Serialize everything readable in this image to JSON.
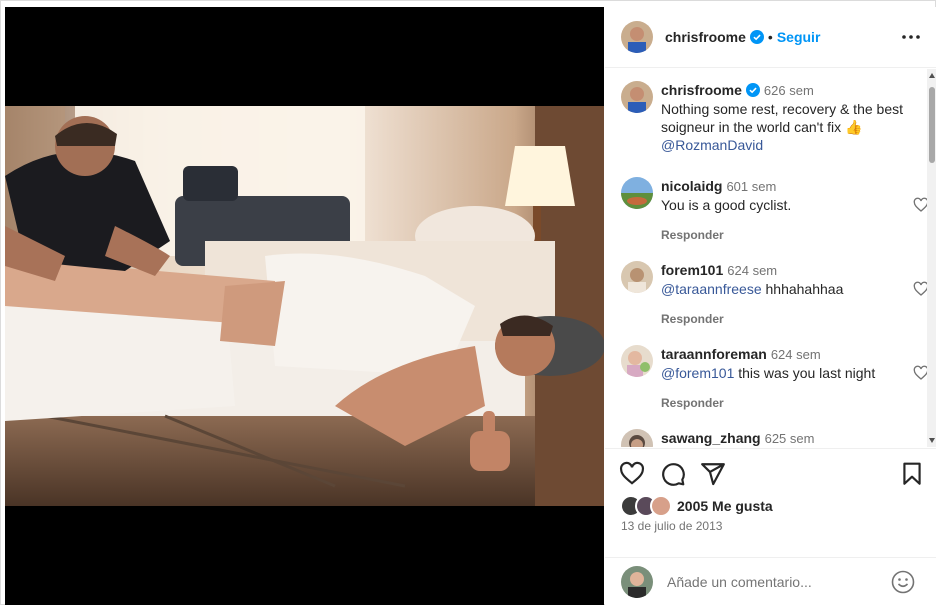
{
  "header": {
    "username": "chrisfroome",
    "separator": "•",
    "follow_label": "Seguir",
    "more_icon": "more-horizontal-icon"
  },
  "caption": {
    "username": "chrisfroome",
    "time": "626 sem",
    "text": "Nothing some rest, recovery & the best soigneur in the world can't fix 👍",
    "mention": "@RozmanDavid"
  },
  "comments": [
    {
      "username": "nicolaidg",
      "time": "601 sem",
      "mention": "",
      "text": "You is a good cyclist.",
      "reply": "Responder"
    },
    {
      "username": "forem101",
      "time": "624 sem",
      "mention": "@taraannfreese",
      "text": " hhhahahhaa",
      "reply": "Responder"
    },
    {
      "username": "taraannforeman",
      "time": "624 sem",
      "mention": "@forem101",
      "text": " this was you last night",
      "reply": "Responder"
    },
    {
      "username": "sawang_zhang",
      "time": "625 sem",
      "mention": "",
      "text": "",
      "reply": ""
    }
  ],
  "likes": {
    "count_text": "2005 Me gusta"
  },
  "date": "13 de julio de 2013",
  "add_comment": {
    "placeholder": "Añade un comentario..."
  },
  "colors": {
    "accent": "#0095f6",
    "verified": "#0095f6",
    "mention": "#385898",
    "muted": "#737373"
  }
}
